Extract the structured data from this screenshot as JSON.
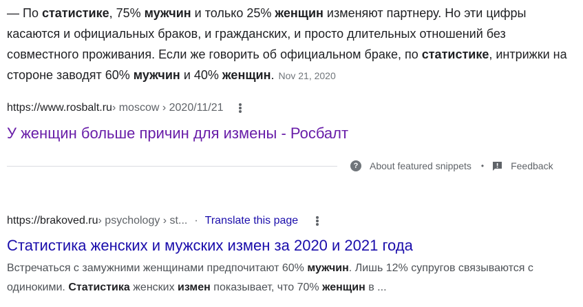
{
  "featured_snippet": {
    "text": {
      "p1": "— По ",
      "b1": "статистике",
      "p2": ", 75% ",
      "b2": "мужчин",
      "p3": " и только 25% ",
      "b3": "женщин",
      "p4": " изменяют партнеру. Но эти цифры касаются и официальных браков, и гражданских, и просто длительных отношений без совместного проживания. Если же говорить об официальном браке, по ",
      "b4": "статистике",
      "p5": ", интрижки на стороне заводят 60% ",
      "b5": "мужчин",
      "p6": " и 40% ",
      "b6": "женщин",
      "p7": "."
    },
    "date": "Nov 21, 2020",
    "cite": {
      "domain": "https://www.rosbalt.ru",
      "path": " › moscow › 2020/11/21"
    },
    "title": "У женщин больше причин для измены - Росбалт",
    "footer": {
      "about_label": "About featured snippets",
      "separator": "•",
      "feedback_label": "Feedback"
    }
  },
  "result": {
    "cite": {
      "domain": "https://brakoved.ru",
      "path": " › psychology › st...",
      "separator": "·",
      "translate_label": "Translate this page"
    },
    "title": "Статистика женских и мужских измен за 2020 и 2021 года",
    "desc": {
      "p1": "Встречаться с замужними женщинами предпочитают 60% ",
      "b1": "мужчин",
      "p2": ". Лишь 12% супругов связываются с одинокими. ",
      "b2": "Статистика",
      "p3": " женских ",
      "b3": "измен",
      "p4": " показывает, что 70% ",
      "b4": "женщин",
      "p5": " в ..."
    }
  },
  "colors": {
    "visited_title": "#681da8",
    "link": "#1a0dab",
    "text": "#202124",
    "muted": "#5f6368"
  },
  "icons": {
    "about": "question-circle-icon",
    "feedback": "feedback-flag-icon",
    "menu": "more-vert-icon"
  }
}
